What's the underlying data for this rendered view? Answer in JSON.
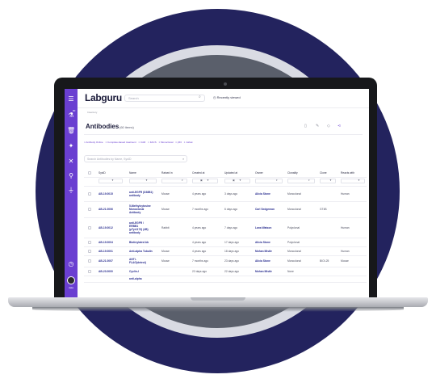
{
  "app": {
    "logo": "Labguru",
    "search_placeholder": "Search",
    "recent_label": "Recently viewed"
  },
  "sidebar": {
    "user_label": "Jake",
    "badge": "90"
  },
  "breadcrumb": "Inventory",
  "page": {
    "title": "Antibodies",
    "count": "(60 items)"
  },
  "tags": [
    "× Antibody Online",
    "× Complete-based treatment",
    "× CAR",
    "× FACS",
    "× Monoclonal",
    "× p53",
    "× Jurkat"
  ],
  "filter_search_placeholder": "Search Antibodies by Name, SysID",
  "table": {
    "headers": [
      "SysID",
      "Name",
      "Raised in",
      "Created at",
      "Updated at",
      "Owner",
      "Clonality",
      "Clone",
      "Reacts with"
    ],
    "rows": [
      {
        "sysid": "AB-19.0015",
        "name": [
          "anti-EGFR (D38B1)",
          "antibody"
        ],
        "raised": "Mouse",
        "created": "4 years ago",
        "updated": "3 days ago",
        "owner": "Alicia Stone",
        "clonality": "Monoclonal",
        "clone": "",
        "reacts": "Human"
      },
      {
        "sysid": "AB-21.0006",
        "name": [
          "5-Methylcytosine",
          "Monoclonal",
          "Antibody"
        ],
        "raised": "Mouse",
        "created": "7 months ago",
        "updated": "6 days ago",
        "owner": "Carl Sedgeman",
        "clonality": "Monoclonal",
        "clone": "GT4B",
        "reacts": ""
      },
      {
        "sysid": "AB-19.0012",
        "name": [
          "anti-EGFR /",
          "ERBB1",
          "(pTyr1173) (4B)",
          "antibody"
        ],
        "raised": "Rabbit",
        "created": "4 years ago",
        "updated": "7 days ago",
        "owner": "Lana Watson",
        "clonality": "Polyclonal",
        "clone": "",
        "reacts": "Human"
      },
      {
        "sysid": "AB-19.0004",
        "name": [
          "Biotinylated Ab"
        ],
        "raised": "",
        "created": "4 years ago",
        "updated": "17 days ago",
        "owner": "Alicia Stone",
        "clonality": "Polyclonal",
        "clone": "",
        "reacts": ""
      },
      {
        "sysid": "AB-19.0001",
        "name": [
          "Anti-alpha Tubulin"
        ],
        "raised": "Mouse",
        "created": "4 years ago",
        "updated": "18 days ago",
        "owner": "Mohan Mistle",
        "clonality": "Monoclonal",
        "clone": "",
        "reacts": "Human"
      },
      {
        "sysid": "AB-21.0007",
        "name": [
          "ANTI-",
          "FLAG(detect)"
        ],
        "raised": "Mouse",
        "created": "7 months ago",
        "updated": "23 days ago",
        "owner": "Alicia Stone",
        "clonality": "Monoclonal",
        "clone": "BIOI-25",
        "reacts": "Mouse"
      },
      {
        "sysid": "AB-23.0000",
        "name": [
          "Cyclin-I"
        ],
        "raised": "",
        "created": "22 days ago",
        "updated": "22 days ago",
        "owner": "Mohan Mistle",
        "clonality": "None",
        "clone": "",
        "reacts": ""
      },
      {
        "sysid": "",
        "name": [
          "anti-alpha"
        ],
        "raised": "",
        "created": "",
        "updated": "",
        "owner": "",
        "clonality": "",
        "clone": "",
        "reacts": ""
      }
    ]
  },
  "colors": {
    "brand_purple": "#6a3fd1",
    "backdrop_navy": "#23235e",
    "link_blue": "#2a2e8f"
  },
  "icons": [
    "menu-icon",
    "flask-icon",
    "trash-icon",
    "bulb-icon",
    "dna-icon",
    "microscope-icon",
    "plug-icon",
    "clock-icon",
    "trash-action-icon",
    "edit-action-icon",
    "tag-action-icon",
    "share-action-icon",
    "search-icon",
    "filter-icon",
    "calendar-icon"
  ]
}
